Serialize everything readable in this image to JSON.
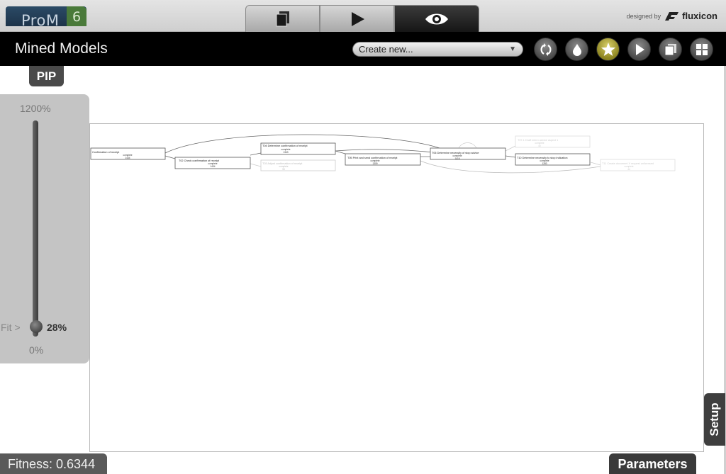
{
  "app": {
    "logo_text": "ProM",
    "logo_version": "6",
    "designed_by": "designed by",
    "brand": "fluxicon"
  },
  "view_tabs": [
    {
      "icon": "workspace-icon",
      "active": false
    },
    {
      "icon": "play-icon",
      "active": false
    },
    {
      "icon": "eye-icon",
      "active": true
    }
  ],
  "header": {
    "title": "Mined Models",
    "create_new": "Create new...",
    "buttons": [
      "refresh-icon",
      "drop-icon",
      "star-icon",
      "play-icon",
      "copy-icon",
      "grid-icon"
    ]
  },
  "pip_label": "PIP",
  "zoom": {
    "max": "1200%",
    "min": "0%",
    "fit": "Fit",
    "value": "28%"
  },
  "model": {
    "nodes": [
      {
        "label": "Confirmation of receipt",
        "lifecycle": "complete",
        "count": "1434",
        "faded": false
      },
      {
        "label": "T02 Check confirmation of receipt",
        "lifecycle": "complete",
        "count": "1434",
        "faded": false
      },
      {
        "label": "T04 Determine confirmation of receipt",
        "lifecycle": "complete",
        "count": "1343",
        "faded": false
      },
      {
        "label": "T03 Adjust confirmation of receipt",
        "lifecycle": "complete",
        "count": "55",
        "faded": true
      },
      {
        "label": "T05 Print and send confirmation of receipt",
        "lifecycle": "complete",
        "count": "1309",
        "faded": false
      },
      {
        "label": "T06 Determine necessity of stop advice",
        "lifecycle": "complete",
        "count": "1416",
        "faded": false
      },
      {
        "label": "T07-1 Draft intern advice aspect 1",
        "lifecycle": "complete",
        "count": "40",
        "faded": true
      },
      {
        "label": "T10 Determine necessity to stop indication",
        "lifecycle": "complete",
        "count": "1283",
        "faded": false
      },
      {
        "label": "T11 Create document X request unlicensed",
        "lifecycle": "complete",
        "count": "44",
        "faded": true
      }
    ]
  },
  "setup_label": "Setup",
  "fitness_label": "Fitness: 0.6344",
  "parameters_label": "Parameters"
}
